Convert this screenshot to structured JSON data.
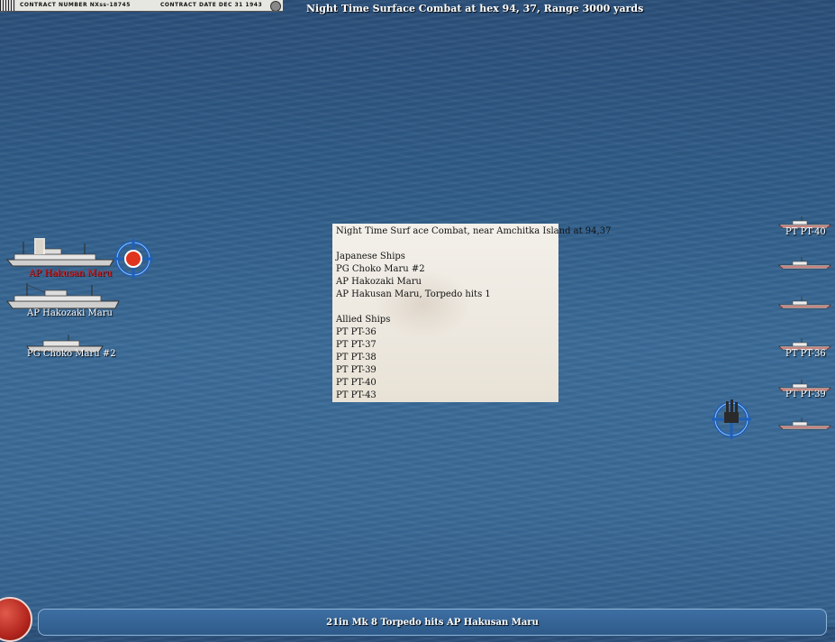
{
  "contract": {
    "number_text": "CONTRACT NUMBER NXss-18745",
    "date_text": "CONTRACT DATE DEC 31 1943"
  },
  "title": "Night Time Surface Combat at hex 94, 37, Range 3000 yards",
  "japanese_ships": [
    {
      "label": "AP Hakusan Maru",
      "status": "hit"
    },
    {
      "label": "AP Hakozaki Maru",
      "status": "normal"
    },
    {
      "label": "PG Choko Maru #2",
      "status": "normal"
    }
  ],
  "allied_ships": [
    {
      "label": "PT PT-40"
    },
    {
      "label": ""
    },
    {
      "label": ""
    },
    {
      "label": "PT PT-36"
    },
    {
      "label": "PT PT-39"
    },
    {
      "label": ""
    }
  ],
  "info_panel": {
    "heading": "Night Time Surf ace Combat, near Amchitka Island at 94,37",
    "japanese_header": "Japanese Ships",
    "japanese_lines": [
      "PG Choko Maru #2",
      "AP Hakozaki Maru",
      "AP Hakusan Maru, Torpedo hits 1"
    ],
    "allied_header": "Allied Ships",
    "allied_lines": [
      "PT PT-36",
      "PT PT-37",
      "PT PT-38",
      "PT PT-39",
      "PT PT-40",
      "PT PT-43"
    ]
  },
  "message": "21in Mk 8 Torpedo hits AP Hakusan Maru",
  "colors": {
    "sea": "#3a6a97",
    "hit_label": "#d21d1d",
    "target_ring": "#1f5fb8",
    "target_center_red": "#e0341e"
  },
  "icons": {
    "target": "crosshair-reticle-icon",
    "attacker": "pt-boat-attack-icon",
    "action": "red-round-button"
  }
}
